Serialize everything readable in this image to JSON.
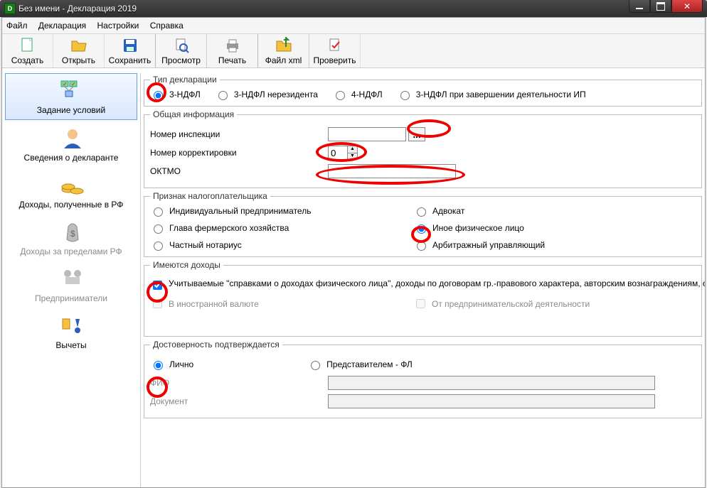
{
  "window": {
    "title": "Без имени - Декларация 2019"
  },
  "menu": {
    "file": "Файл",
    "declaration": "Декларация",
    "settings": "Настройки",
    "help": "Справка"
  },
  "toolbar": {
    "create": "Создать",
    "open": "Открыть",
    "save": "Сохранить",
    "preview": "Просмотр",
    "print": "Печать",
    "xml": "Файл xml",
    "check": "Проверить"
  },
  "sidebar": {
    "conditions": "Задание условий",
    "declarant": "Сведения о декларанте",
    "income_rf": "Доходы, полученные в РФ",
    "income_abroad": "Доходы за пределами РФ",
    "entrepreneurs": "Предприниматели",
    "deductions": "Вычеты"
  },
  "form": {
    "decl_type": {
      "legend": "Тип декларации",
      "ndfl3": "3-НДФЛ",
      "ndfl3_nonres": "3-НДФЛ нерезидента",
      "ndfl4": "4-НДФЛ",
      "ndfl3_ip_end": "3-НДФЛ при завершении деятельности ИП"
    },
    "general": {
      "legend": "Общая информация",
      "inspection": "Номер инспекции",
      "correction": "Номер корректировки",
      "correction_value": "0",
      "oktmo": "ОКТМО",
      "ellipsis": "..."
    },
    "taxpayer": {
      "legend": "Признак налогоплательщика",
      "ip": "Индивидуальный предприниматель",
      "advocate": "Адвокат",
      "farm": "Глава фермерского хозяйства",
      "other_person": "Иное физическое лицо",
      "notary": "Частный нотариус",
      "arbitr": "Арбитражный управляющий"
    },
    "income": {
      "legend": "Имеются доходы",
      "spravka": "Учитываемые \"справками о доходах физического лица\", доходы по договорам гр.-правового характера, авторским вознаграждениям, от продажи имущества и др.",
      "foreign": "В иностранной валюте",
      "business": "От предпринимательской деятельности"
    },
    "authenticity": {
      "legend": "Достоверность подтверждается",
      "self": "Лично",
      "rep_fl": "Представителем - ФЛ",
      "fio": "ФИО",
      "doc": "Документ"
    }
  }
}
